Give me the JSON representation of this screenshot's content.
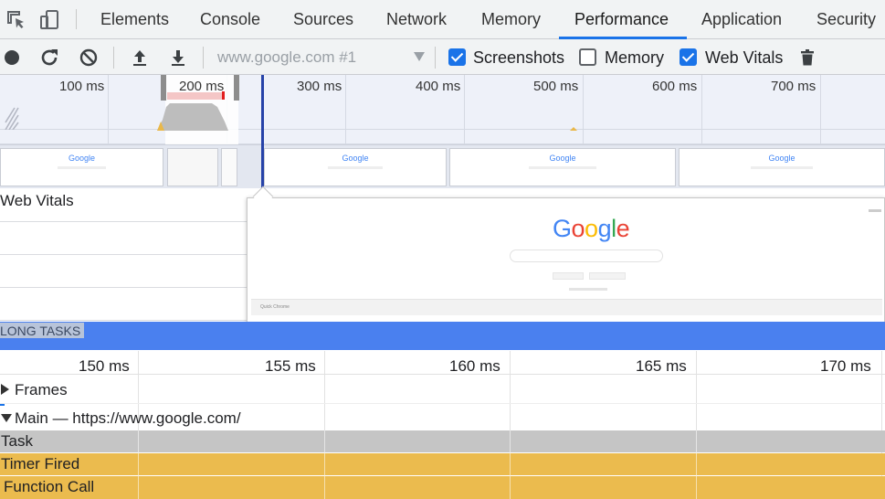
{
  "tabs": [
    {
      "label": "Elements"
    },
    {
      "label": "Console"
    },
    {
      "label": "Sources"
    },
    {
      "label": "Network"
    },
    {
      "label": "Memory"
    },
    {
      "label": "Performance",
      "active": true
    },
    {
      "label": "Application"
    },
    {
      "label": "Security"
    }
  ],
  "toolbar": {
    "profile_select": "www.google.com #1",
    "screenshots": {
      "label": "Screenshots",
      "checked": true
    },
    "memory": {
      "label": "Memory",
      "checked": false
    },
    "web_vitals": {
      "label": "Web Vitals",
      "checked": true
    },
    "icons": [
      "record-icon",
      "reload-icon",
      "clear-icon",
      "upload-icon",
      "download-icon",
      "trash-icon"
    ]
  },
  "overview": {
    "ticks": [
      "100 ms",
      "200 ms",
      "300 ms",
      "400 ms",
      "500 ms",
      "600 ms",
      "700 ms"
    ]
  },
  "vitals": {
    "label": "Web Vitals"
  },
  "screenshot_preview": {
    "logo": "Google",
    "footer": "Quick Chrome"
  },
  "long_tasks": {
    "label": "LONG TASKS"
  },
  "timeline": {
    "ticks": [
      "150 ms",
      "155 ms",
      "160 ms",
      "165 ms",
      "170 ms"
    ],
    "frames_label": "Frames",
    "main_label": "Main — https://www.google.com/",
    "flame": {
      "task": "Task",
      "timer": "Timer Fired",
      "function_call": "Function Call"
    }
  },
  "colors": {
    "accent": "#1a73e8",
    "long_tasks": "#4a80ef",
    "task": "#c5c5c5",
    "scripting": "#ebbb4e",
    "cursor": "#2743a8"
  }
}
